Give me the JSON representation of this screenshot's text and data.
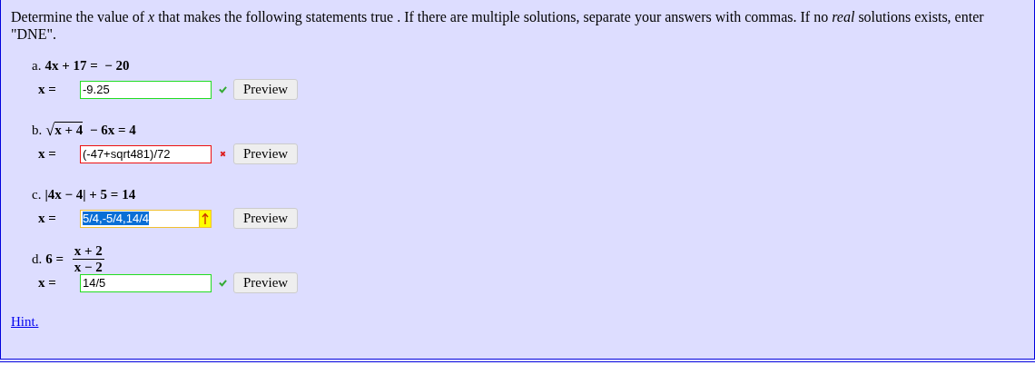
{
  "instructions": "Determine the value of *x* that makes the following statements true . If there are multiple solutions, separate your answers with commas. If no *real* solutions exists, enter \"DNE\".",
  "parts": [
    {
      "label": "a.",
      "equation": [
        {
          "kind": "text",
          "text": "4x + 17 =  − 20"
        }
      ],
      "answer_label": "x =",
      "answer": "-9.25",
      "kind": "correct",
      "highlighted": false,
      "button": "Preview"
    },
    {
      "label": "b.",
      "equation": [
        {
          "kind": "sqrt",
          "radical": "√",
          "text": "x + 4"
        },
        {
          "kind": "text",
          "text": " − 6x = 4"
        }
      ],
      "answer_label": "x =",
      "answer": "(-47+sqrt481)/72",
      "kind": "incorrect",
      "highlighted": false,
      "button": "Preview"
    },
    {
      "label": "c.",
      "equation": [
        {
          "kind": "text",
          "text": "|4x − 4| + 5 = 14"
        }
      ],
      "answer_label": "x =",
      "answer": "5/4,-5/4,14/4",
      "kind": "warning",
      "highlighted": true,
      "button": "Preview"
    },
    {
      "label": "d.",
      "equation": [
        {
          "kind": "text",
          "text": "6 = "
        },
        {
          "kind": "fraction",
          "numerator": "x + 2",
          "denominator": "x − 2"
        }
      ],
      "answer_label": "x =",
      "answer": "14/5",
      "kind": "correct",
      "highlighted": false,
      "button": "Preview"
    }
  ],
  "hint": "Hint."
}
